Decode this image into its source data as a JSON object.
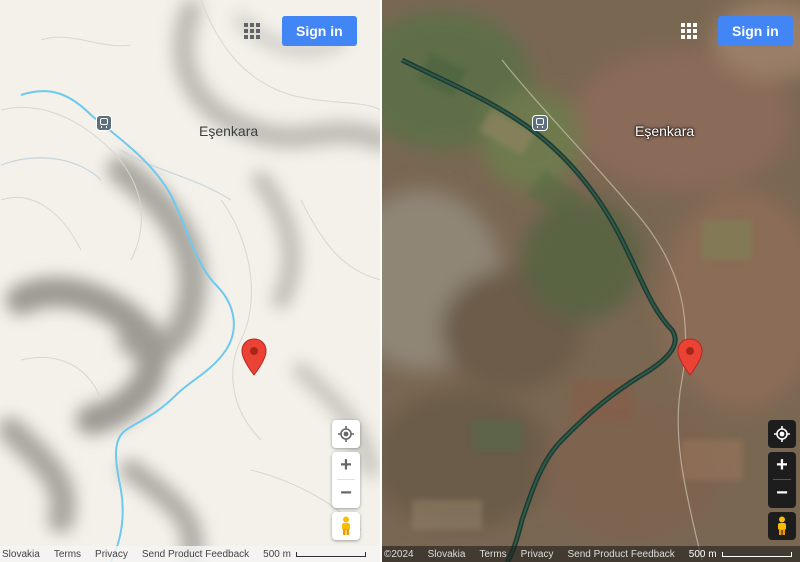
{
  "header": {
    "sign_in_label": "Sign in"
  },
  "map": {
    "place_label": "Eşenkara",
    "icons": {
      "apps": "apps-grid-icon",
      "transit": "transit-station-icon",
      "pin": "location-pin-icon",
      "locate": "my-location-icon",
      "pegman": "street-view-pegman-icon"
    }
  },
  "controls": {
    "zoom_in": "+",
    "zoom_out": "−"
  },
  "footer_left": {
    "region": "Slovakia",
    "terms": "Terms",
    "privacy": "Privacy",
    "feedback": "Send Product Feedback",
    "scale": "500 m"
  },
  "footer_right": {
    "copyright": "©2024",
    "region": "Slovakia",
    "terms": "Terms",
    "privacy": "Privacy",
    "feedback": "Send Product Feedback",
    "scale": "500 m"
  },
  "colors": {
    "accent": "#4285f4",
    "pin": "#ea4335",
    "river": "#6ec9f0"
  }
}
